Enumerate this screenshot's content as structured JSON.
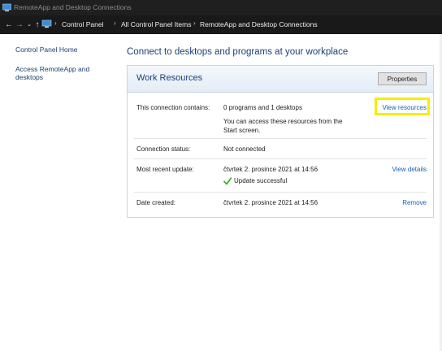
{
  "window": {
    "title": "RemoteApp and Desktop Connections"
  },
  "addressbar": {
    "crumbs": [
      "Control Panel",
      "All Control Panel Items",
      "RemoteApp and Desktop Connections"
    ]
  },
  "sidebar": {
    "items": [
      {
        "label": "Control Panel Home"
      },
      {
        "label": "Access RemoteApp and desktops"
      }
    ]
  },
  "main": {
    "heading": "Connect to desktops and programs at your workplace",
    "panel": {
      "title": "Work Resources",
      "properties_label": "Properties",
      "rows": [
        {
          "label": "This connection contains:",
          "value": "0 programs and 1 desktops",
          "detail": "You can access these resources from the Start screen.",
          "action": "View resources"
        },
        {
          "label": "Connection status:",
          "value": "Not connected"
        },
        {
          "label": "Most recent update:",
          "value": "čtvrtek 2. prosince 2021 at 14:56",
          "status": "Update successful",
          "action": "View details"
        },
        {
          "label": "Date created:",
          "value": "čtvrtek 2. prosince 2021 at 14:56",
          "action": "Remove"
        }
      ]
    }
  },
  "colors": {
    "link": "#1a5fb4",
    "heading": "#1b3f75",
    "highlight": "#f5ee0a",
    "check": "#3fae2a"
  },
  "icons": [
    "app-icon",
    "back-arrow-icon",
    "forward-arrow-icon",
    "history-dropdown-icon",
    "up-arrow-icon",
    "control-panel-icon",
    "checkmark-icon"
  ]
}
